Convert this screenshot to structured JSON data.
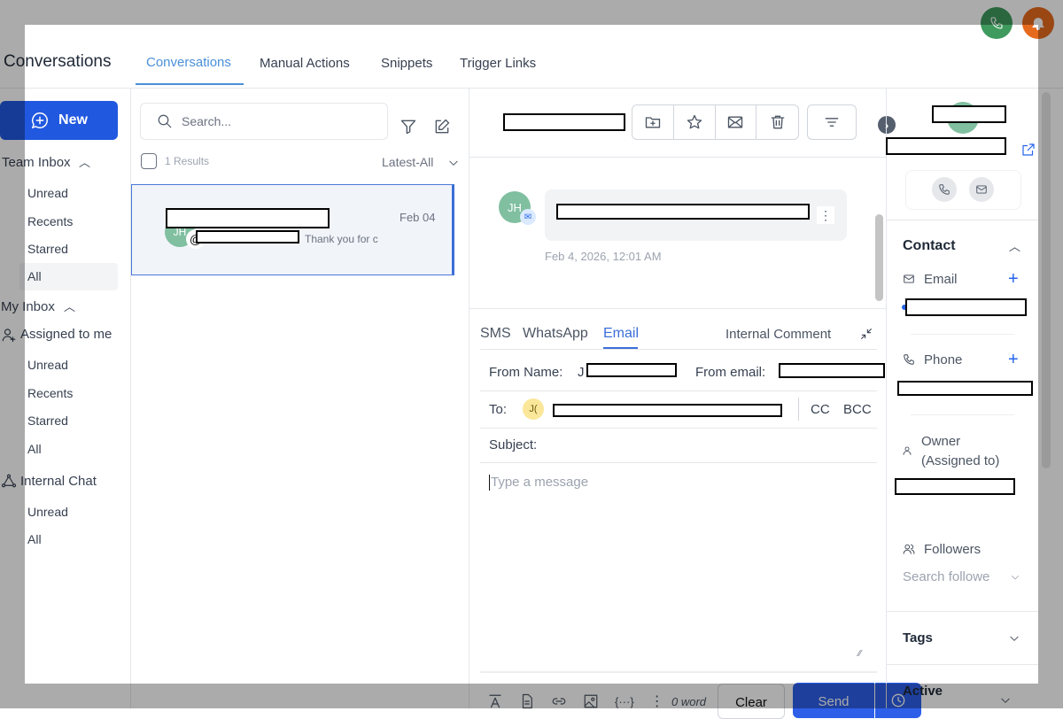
{
  "header": {
    "title": "Conversations",
    "tabs": [
      {
        "label": "Conversations",
        "active": true
      },
      {
        "label": "Manual Actions"
      },
      {
        "label": "Snippets"
      },
      {
        "label": "Trigger Links"
      }
    ]
  },
  "sidebar": {
    "new_label": "New",
    "team_inbox": "Team Inbox",
    "team_items": [
      "Unread",
      "Recents",
      "Starred",
      "All"
    ],
    "my_inbox": "My Inbox",
    "assigned": "Assigned to me",
    "my_items": [
      "Unread",
      "Recents",
      "Starred",
      "All"
    ],
    "internal_chat": "Internal Chat",
    "chat_items": [
      "Unread",
      "All"
    ]
  },
  "list": {
    "search_placeholder": "Search...",
    "results": "1 Results",
    "sort": "Latest-All",
    "items": [
      {
        "initials": "JH",
        "date": "Feb 04",
        "preview": "Thank you for c"
      }
    ]
  },
  "thread": {
    "avatar": "JH",
    "timestamp": "Feb 4, 2026, 12:01 AM"
  },
  "composer": {
    "tabs": [
      "SMS",
      "WhatsApp",
      "Email"
    ],
    "active_tab": "Email",
    "internal_comment": "Internal Comment",
    "from_name_label": "From Name:",
    "from_name_initial": "J",
    "from_email_label": "From email:",
    "to_label": "To:",
    "to_avatar": "J(",
    "cc": "CC",
    "bcc": "BCC",
    "subject_label": "Subject:",
    "message_placeholder": "Type a message",
    "word_count": "0 word",
    "clear": "Clear",
    "send": "Send"
  },
  "contact": {
    "section": "Contact",
    "email": "Email",
    "phone": "Phone",
    "owner": "Owner",
    "owner2": "(Assigned to)",
    "followers": "Followers",
    "followers_placeholder": "Search followe",
    "tags": "Tags",
    "active": "Active"
  },
  "colors": {
    "primary": "#2158e0",
    "accent_tab": "#4a90d9",
    "avatar": "#80bfa0"
  }
}
